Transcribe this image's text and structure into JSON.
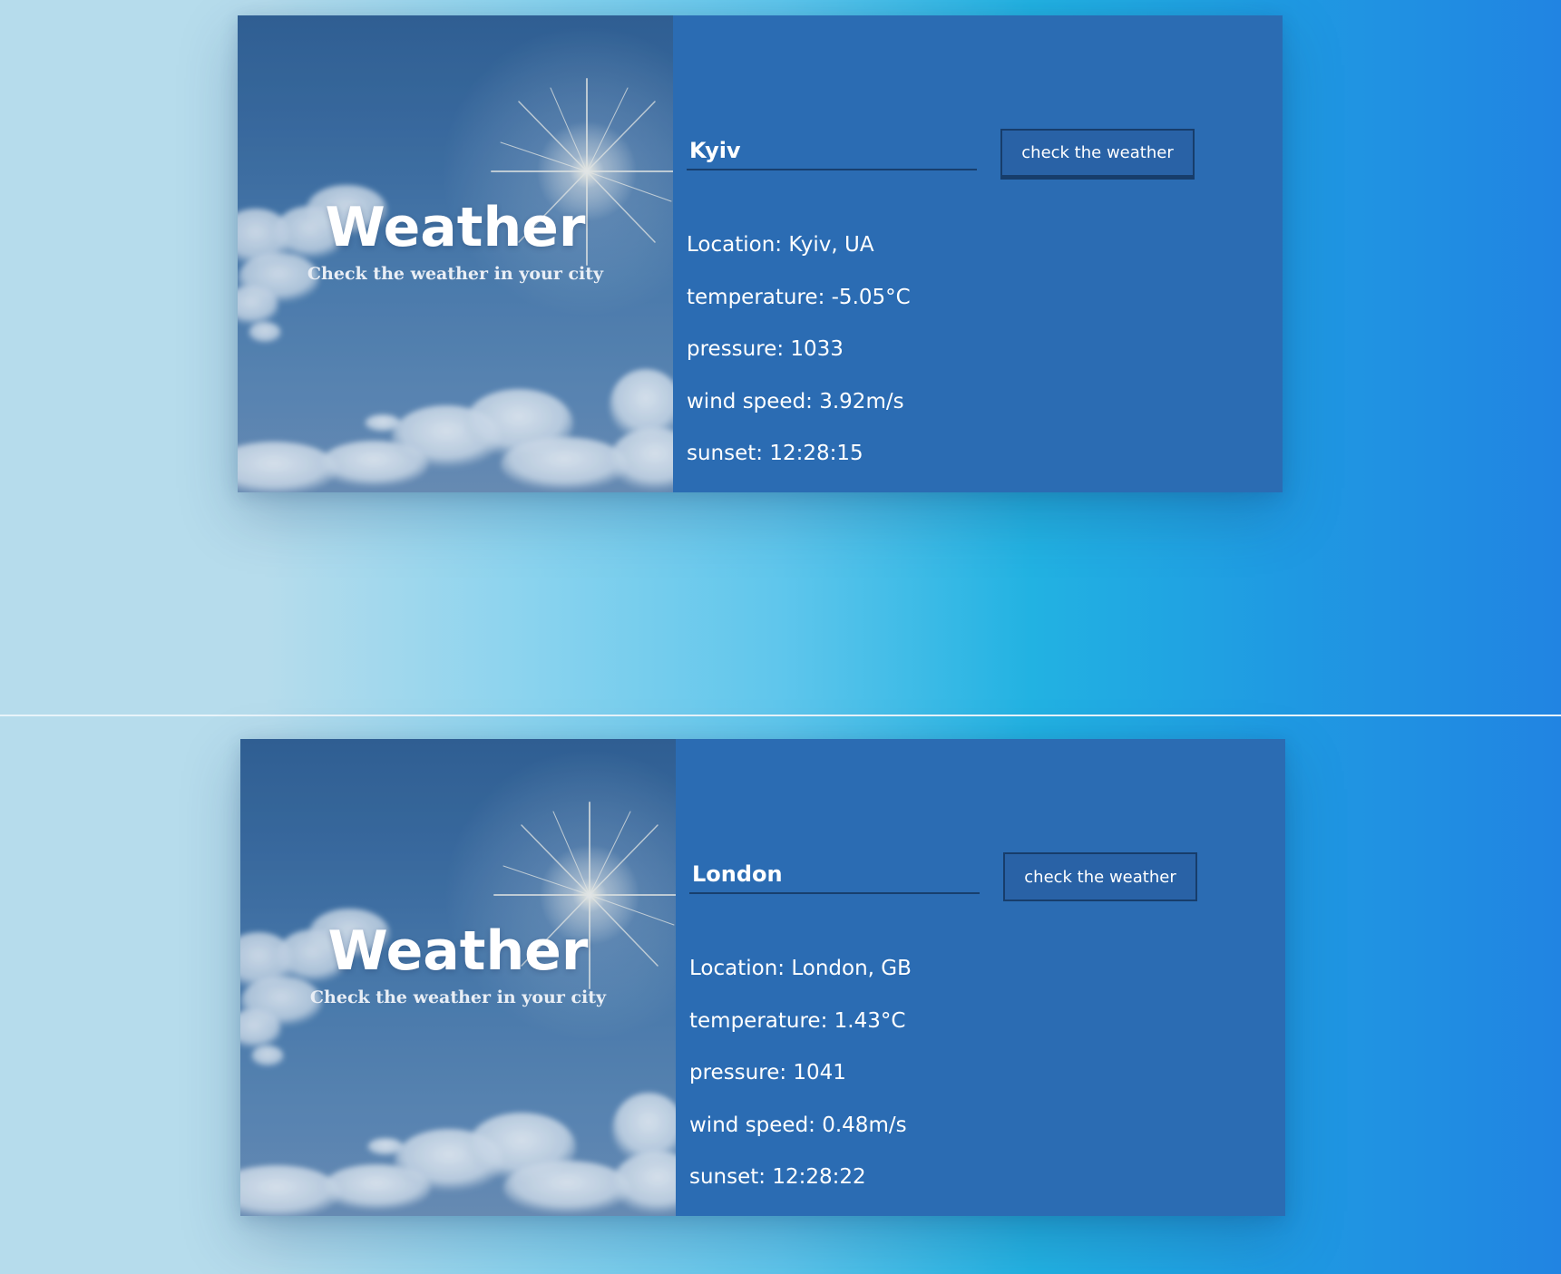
{
  "colors": {
    "panel": "#2b6cb3",
    "button_border": "#173d6b",
    "text": "#ffffff"
  },
  "cards": [
    {
      "hero": {
        "title": "Weather",
        "subtitle": "Check the weather in your city"
      },
      "search": {
        "value": "Kyiv",
        "button_label": "check the weather"
      },
      "info": {
        "location": "Location: Kyiv, UA",
        "temperature": "temperature: -5.05°C",
        "pressure": "pressure: 1033",
        "wind_speed": "wind speed: 3.92m/s",
        "sunset": "sunset: 12:28:15"
      }
    },
    {
      "hero": {
        "title": "Weather",
        "subtitle": "Check the weather in your city"
      },
      "search": {
        "value": "London",
        "button_label": "check the weather"
      },
      "info": {
        "location": "Location: London, GB",
        "temperature": "temperature: 1.43°C",
        "pressure": "pressure: 1041",
        "wind_speed": "wind speed: 0.48m/s",
        "sunset": "sunset: 12:28:22"
      }
    }
  ]
}
